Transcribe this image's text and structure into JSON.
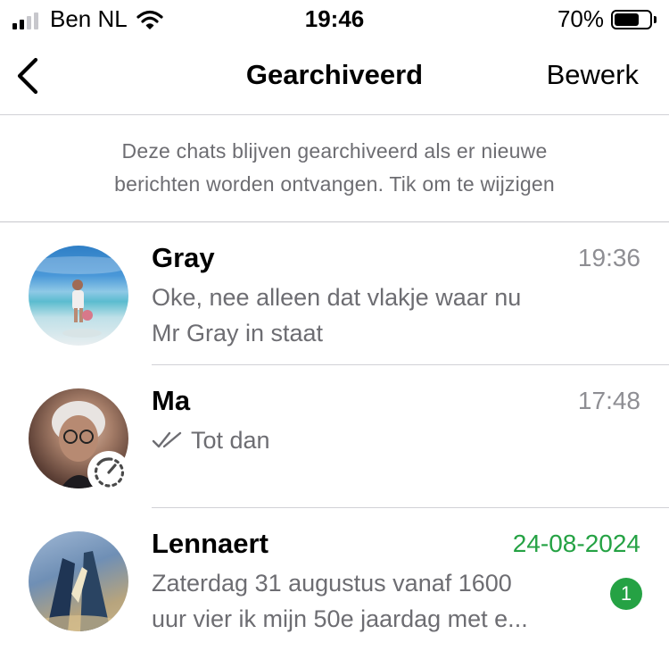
{
  "status_bar": {
    "carrier": "Ben NL",
    "time": "19:46",
    "battery": "70%",
    "battery_level": 0.7
  },
  "nav": {
    "title": "Gearchiveerd",
    "edit_label": "Bewerk"
  },
  "notice": {
    "line1": "Deze chats blijven gearchiveerd als er nieuwe",
    "line2": "berichten worden ontvangen. Tik om te wijzigen"
  },
  "chats": [
    {
      "name": "Gray",
      "time": "19:36",
      "preview_line1": "Oke, nee alleen dat vlakje waar nu",
      "preview_line2": "Mr Gray in staat"
    },
    {
      "name": "Ma",
      "time": "17:48",
      "preview_line1": "Tot dan",
      "status": "read-ticks-icon"
    },
    {
      "name": "Lennaert",
      "time": "24-08-2024",
      "preview_line1": "Zaterdag 31 augustus vanaf 1600",
      "preview_line2": "uur vier ik mijn 50e jaardag met e...",
      "unread": "1"
    }
  ],
  "colors": {
    "accent_green": "#25a244",
    "secondary_text": "#8e8e93",
    "divider": "#d1d1d6"
  }
}
